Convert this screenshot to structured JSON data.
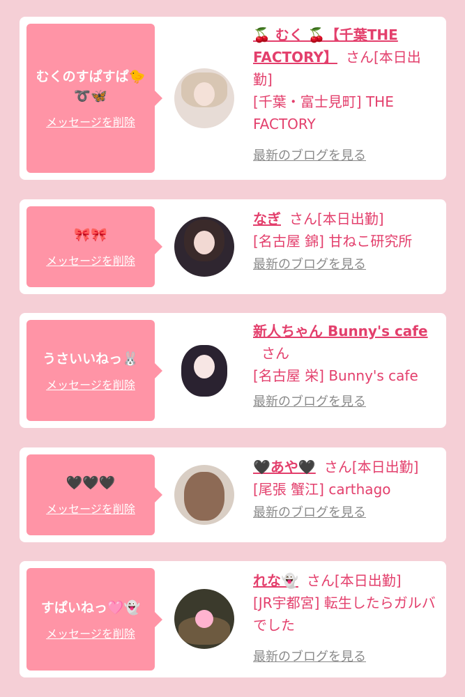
{
  "theme": {
    "accent": "#e33f6c",
    "bubble": "#ff94a6",
    "background": "#f5cfd6"
  },
  "cards": [
    {
      "message": "むくのすぱすぱ🐤\n➰🦋",
      "delete_label": "メッセージを削除",
      "name": "🍒 むく 🍒【千葉THE FACTORY】",
      "san": "さん",
      "status": "[本日出勤]",
      "shop": "[千葉・富士見町] THE FACTORY",
      "blog_label": "最新のブログを見る"
    },
    {
      "message": "🎀🎀",
      "delete_label": "メッセージを削除",
      "name": "なぎ",
      "san": "さん",
      "status": "[本日出勤]",
      "shop": "[名古屋 錦] 甘ねこ研究所",
      "blog_label": "最新のブログを見る"
    },
    {
      "message": "うさいいねっ🐰",
      "delete_label": "メッセージを削除",
      "name": "新人ちゃん Bunny's cafe",
      "san": "さん",
      "status": "",
      "shop": "[名古屋 栄] Bunny's cafe",
      "blog_label": "最新のブログを見る"
    },
    {
      "message": "🖤🖤🖤",
      "delete_label": "メッセージを削除",
      "name": "🖤あや🖤",
      "san": "さん",
      "status": "[本日出勤]",
      "shop": "[尾張 蟹江] carthago",
      "blog_label": "最新のブログを見る"
    },
    {
      "message": "すぱいねっ🩷👻",
      "delete_label": "メッセージを削除",
      "name": "れな👻",
      "san": "さん",
      "status": "[本日出勤]",
      "shop": "[JR宇都宮] 転生したらガルバでした",
      "blog_label": "最新のブログを見る"
    }
  ]
}
